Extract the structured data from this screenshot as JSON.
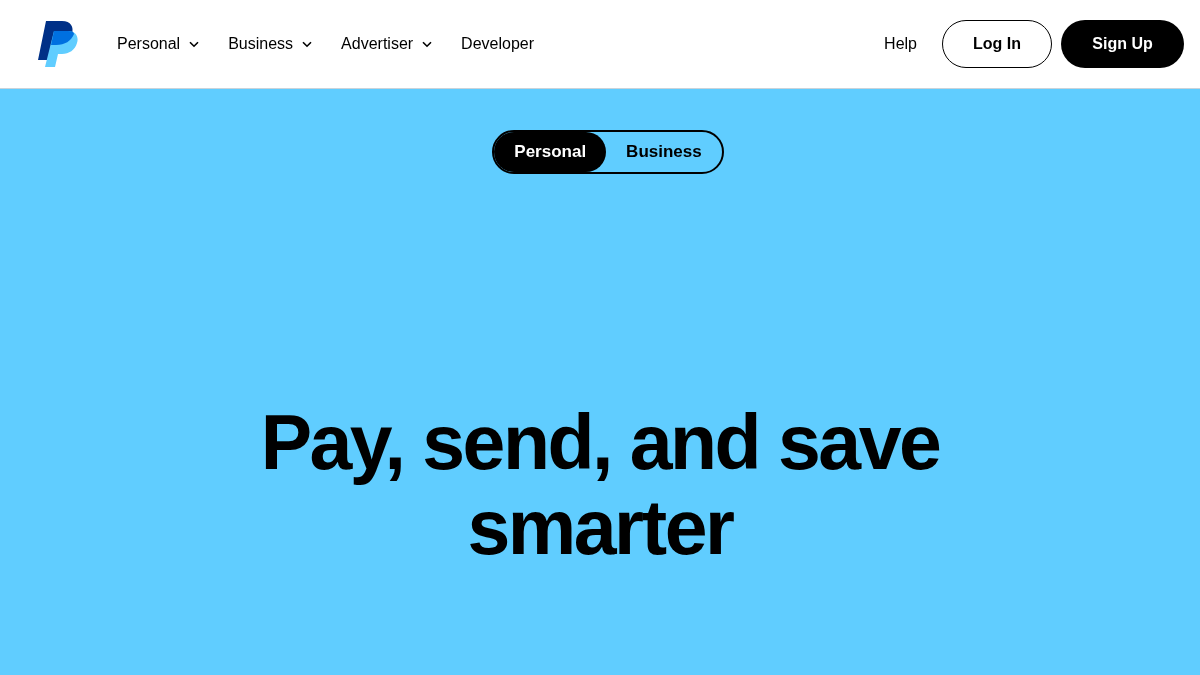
{
  "header": {
    "nav": [
      {
        "label": "Personal",
        "dropdown": true
      },
      {
        "label": "Business",
        "dropdown": true
      },
      {
        "label": "Advertiser",
        "dropdown": true
      },
      {
        "label": "Developer",
        "dropdown": false
      }
    ],
    "help": "Help",
    "login": "Log In",
    "signup": "Sign Up"
  },
  "hero": {
    "toggle": [
      {
        "label": "Personal",
        "selected": true
      },
      {
        "label": "Business",
        "selected": false
      }
    ],
    "heading": "Pay, send, and save smarter"
  }
}
